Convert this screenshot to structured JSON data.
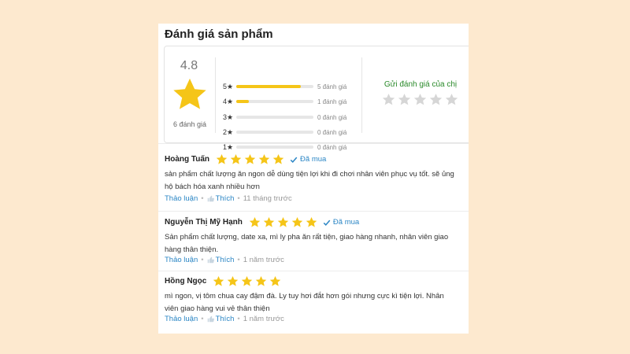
{
  "section_title": "Đánh giá sản phẩm",
  "summary": {
    "average": "4.8",
    "total_label": "6 đánh giá",
    "star_fill_color": "#f5c518",
    "bars": [
      {
        "label": "5★",
        "count_label": "5 đánh giá",
        "fraction": 0.833
      },
      {
        "label": "4★",
        "count_label": "1 đánh giá",
        "fraction": 0.167
      },
      {
        "label": "3★",
        "count_label": "0 đánh giá",
        "fraction": 0
      },
      {
        "label": "2★",
        "count_label": "0 đánh giá",
        "fraction": 0
      },
      {
        "label": "1★",
        "count_label": "0 đánh giá",
        "fraction": 0
      }
    ],
    "send_review_label": "Gửi đánh giá của chị",
    "empty_star_count": 5
  },
  "reviews": [
    {
      "name": "Hoàng Tuấn",
      "stars": 5,
      "verified_label": "Đã mua",
      "verified": true,
      "text": "sản phẩm chất lượng ăn ngon dễ dùng tiện lợi khi đi chơi nhân viên phục vụ tốt. sẽ ủng hộ bách hóa xanh nhiều hơn",
      "discuss_label": "Thảo luận",
      "like_label": "Thích",
      "time": "11 tháng trước"
    },
    {
      "name": "Nguyễn Thị Mỹ Hạnh",
      "stars": 5,
      "verified_label": "Đã mua",
      "verified": true,
      "text": "Sản phẩm chất lượng, date xa, mì ly pha ăn rất tiện, giao hàng nhanh, nhân viên giao hàng thân thiện.",
      "discuss_label": "Thảo luận",
      "like_label": "Thích",
      "time": "1 năm trước"
    },
    {
      "name": "Hồng Ngọc",
      "stars": 5,
      "verified_label": "",
      "verified": false,
      "text": "mì ngon, vị tôm chua cay đậm đà. Ly tuy hơi đắt hơn gói nhưng cực kì tiện lợi. Nhân viên giao hàng vui vẻ thân thiện",
      "discuss_label": "Thảo luận",
      "like_label": "Thích",
      "time": "1 năm trước"
    }
  ]
}
